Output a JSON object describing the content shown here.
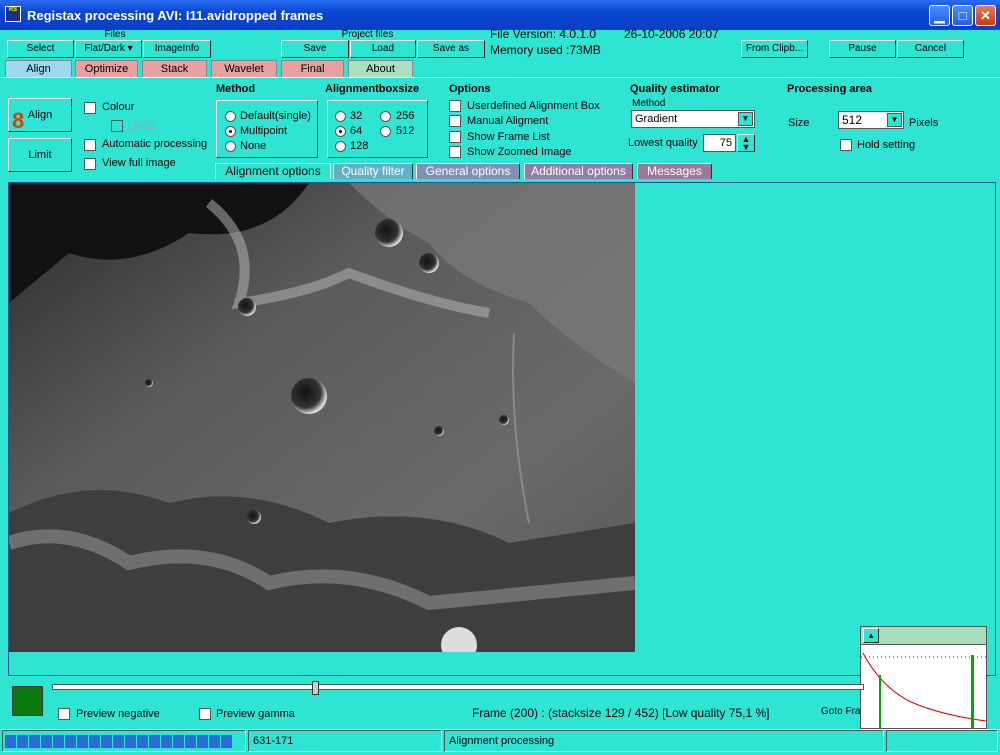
{
  "window": {
    "title": "Registax processing AVI: I11.avidropped frames",
    "icon_text": "RS",
    "minimize_icon": "minimize-icon",
    "maximize_icon": "maximize-icon",
    "close_icon": "close-icon"
  },
  "files": {
    "label": "Files",
    "select": "Select",
    "flatdark": "Flat/Dark",
    "imageinfo": "ImageInfo"
  },
  "project_files": {
    "label": "Project files",
    "save": "Save",
    "load": "Load",
    "save_as": "Save as"
  },
  "info": {
    "file_version": "File Version: 4.0.1.0",
    "date": "26-10-2006 20:07",
    "memory": "Memory used :73MB"
  },
  "toolbar": {
    "from_clipboard": "From Clipb...",
    "pause": "Pause",
    "cancel": "Cancel"
  },
  "main_tabs": [
    {
      "label": "Align",
      "color": "#9dd8f0"
    },
    {
      "label": "Optimize",
      "color": "#e8a0a0"
    },
    {
      "label": "Stack",
      "color": "#e8a0a0"
    },
    {
      "label": "Wavelet",
      "color": "#e8a0a0"
    },
    {
      "label": "Final",
      "color": "#e8a0a0"
    },
    {
      "label": "About",
      "color": "#a8e0c0"
    }
  ],
  "align_panel": {
    "align_button": "Align",
    "align_marker": "8",
    "limit_button": "Limit",
    "colour": "Colour",
    "lrgb": "LRGB",
    "automatic_processing": "Automatic processing",
    "view_full_image": "View full image"
  },
  "method": {
    "title": "Method",
    "options": [
      "Default(single)",
      "Multipoint",
      "None"
    ],
    "selected": "Multipoint"
  },
  "alignmentboxsize": {
    "title": "Alignmentboxsize",
    "options": [
      "32",
      "256",
      "64",
      "512",
      "128"
    ],
    "selected": "64"
  },
  "options": {
    "title": "Options",
    "items": [
      "Userdefined Alignment Box",
      "Manual Aligment",
      "Show Frame List",
      "Show Zoomed Image"
    ]
  },
  "quality_estimator": {
    "title": "Quality estimator",
    "method_label": "Method",
    "method_value": "Gradient",
    "lowest_quality_label": "Lowest quality",
    "lowest_quality_value": "75"
  },
  "processing_area": {
    "title": "Processing area",
    "size_label": "Size",
    "size_value": "512",
    "pixels_label": "Pixels",
    "hold_setting": "Hold setting"
  },
  "sub_tabs": [
    "Alignment  options",
    "Quality  filter",
    "General options",
    "Additional options",
    "Messages"
  ],
  "bottom": {
    "preview_negative": "Preview negative",
    "preview_gamma": "Preview gamma",
    "frame_info": "Frame (200) :  (stacksize 129 / 452) [Low quality 75,1 %]",
    "goto_frame": "Goto Fra",
    "slider_value": 0.32
  },
  "status": {
    "progress_blocks": 19,
    "coords": "631-171",
    "message": "Alignment processing"
  },
  "colors": {
    "background": "#2ee4d2",
    "titlebar": "#0a46d2",
    "color_swatch": "#0a7a10"
  }
}
